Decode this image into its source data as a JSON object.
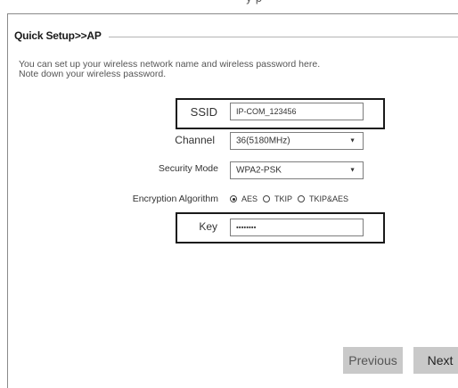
{
  "top_caption": "y     p",
  "heading": "Quick Setup>>AP",
  "intro": {
    "line1": "You can set up your wireless network name and wireless password here.",
    "line2": "Note down your wireless password."
  },
  "form": {
    "ssid": {
      "label": "SSID",
      "value": "IP-COM_123456"
    },
    "channel": {
      "label": "Channel",
      "value": "36(5180MHz)"
    },
    "security_mode": {
      "label": "Security Mode",
      "value": "WPA2-PSK"
    },
    "encryption": {
      "label": "Encryption Algorithm",
      "options": [
        "AES",
        "TKIP",
        "TKIP&AES"
      ],
      "selected": "AES"
    },
    "key": {
      "label": "Key",
      "value": "••••••••"
    }
  },
  "buttons": {
    "previous": "Previous",
    "next": "Next"
  },
  "icons": {
    "dropdown_arrow": "▼"
  }
}
